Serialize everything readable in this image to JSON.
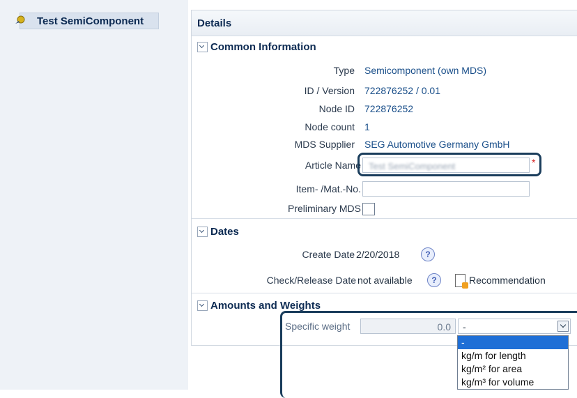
{
  "tree": {
    "node_label": "Test SemiComponent"
  },
  "panel": {
    "title": "Details"
  },
  "common": {
    "section_title": "Common Information",
    "type_label": "Type",
    "type_value": "Semicomponent (own MDS)",
    "id_label": "ID / Version",
    "id_value": "722876252 / 0.01",
    "node_id_label": "Node ID",
    "node_id_value": "722876252",
    "node_count_label": "Node count",
    "node_count_value": "1",
    "supplier_label": "MDS Supplier",
    "supplier_value": "SEG Automotive Germany GmbH",
    "article_label": "Article Name",
    "article_value": "Test SemiComponent",
    "item_label": "Item- /Mat.-No.",
    "item_value": "",
    "preliminary_label": "Preliminary MDS",
    "required_marker": "*"
  },
  "dates": {
    "section_title": "Dates",
    "create_label": "Create Date",
    "create_value": "2/20/2018",
    "check_label": "Check/Release Date",
    "check_value": "not available",
    "help_glyph": "?",
    "recommendation_label": "Recommendation"
  },
  "amounts": {
    "section_title": "Amounts and Weights",
    "specific_weight_label": "Specific weight",
    "specific_weight_value": "0.0",
    "unit_selected": "-",
    "unit_options": [
      "-",
      "kg/m for length",
      "kg/m² for area",
      "kg/m³ for volume"
    ]
  },
  "colors": {
    "highlight": "#1a3d5c",
    "selected_option": "#1f6fd6",
    "required": "#d62020"
  }
}
